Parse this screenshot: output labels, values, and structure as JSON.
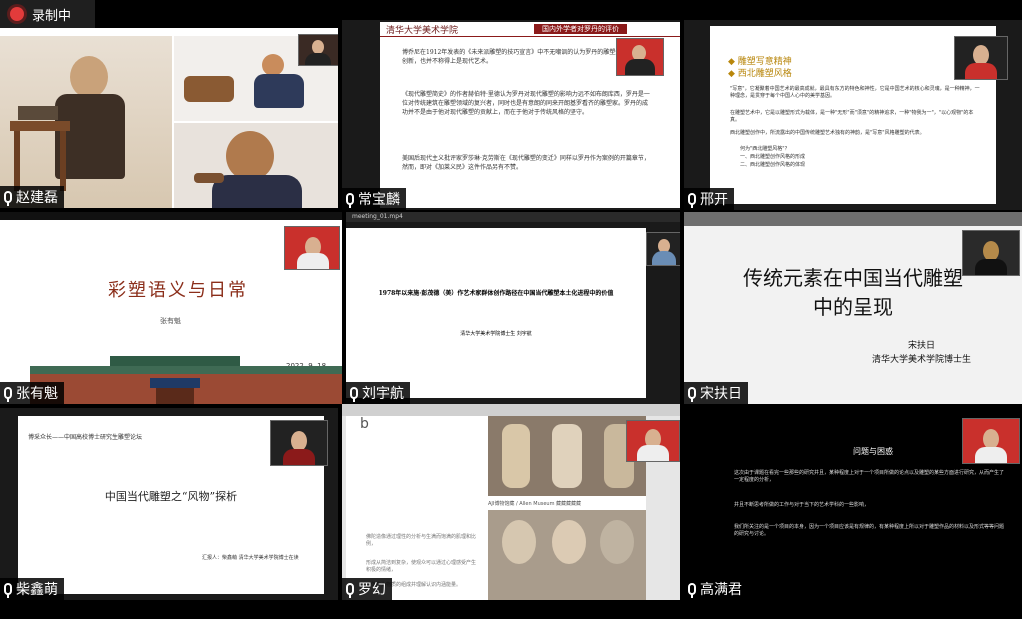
{
  "recording": {
    "label": "录制中"
  },
  "tiles": [
    {
      "name": "赵建磊"
    },
    {
      "name": "常宝麟",
      "slide_header": "清华大学美术学院",
      "slide_section": "国内外学者对罗丹的评价",
      "paras": [
        "博乔尼在1912年发表的《未来派雕塑的技巧宣言》中不无嘲讽的认为罗丹的雕塑并没有完全的创新，也并不称得上是现代艺术。",
        "《现代雕塑简史》的作者赫伯特·里德认为罗丹对现代雕塑的影响力远不如布朗库西，罗丹是一位对传统建筑在雕塑领域的复兴者，同时也是有意朗的同来开朗基罗看齐的雕塑家。罗丹的成功并不是由于他对现代雕塑的贡献上，而在于他对于传统风格的坚守。",
        "美国后现代主义批评家罗莎琳·克劳斯在《现代雕塑的变迁》同样以罗丹作为案例的开篇章节，然而，即对《加莱义民》这件作品另有不赞。"
      ]
    },
    {
      "name": "邢开",
      "bullets": [
        "雕塑写意精神",
        "西北雕塑风格"
      ],
      "paras": [
        "\"写意\"，它凝聚着中国艺术的最高成就，最具有东方的特色和神性，它是中国艺术的核心和灵魂，是一种精神，一种理念，是贯穿于每个中国人心中的美学基因。",
        "在雕塑艺术中，它是以雕塑形式为载体，是一种\"无形\"而\"须意\"的精神追求，一种\"物我为一\"，\"以心观物\"的本真。",
        "西北雕塑创作中，所流露出的中国传统雕塑艺术独有的神韵，是\"写意\"风格雕塑的代表。",
        "何为\"西北雕塑风格\"？",
        "一、西北雕塑创作风格的形成",
        "二、西北雕塑创作风格的体现"
      ]
    },
    {
      "name": "张有魁",
      "title": "彩塑语义与日常",
      "author": "张有魁",
      "date": "2022. 9. 18"
    },
    {
      "name": "刘宇航",
      "title": "1978年以来施·彭茂德（美）作艺术家群体创作路径在中国当代雕塑本土化进程中的价值",
      "subtitle": "清华大学美术学院博士生 刘宇航",
      "filename": "meeting_01.mp4"
    },
    {
      "name": "宋扶日",
      "title_line1": "传统元素在中国当代雕塑",
      "title_line2": "中的呈现",
      "author": "宋扶日",
      "affiliation": "清华大学美术学院博士生"
    },
    {
      "name": "柴鑫萌",
      "forum": "博采众长——中国高校博士研究生雕塑论坛",
      "title": "中国当代雕塑之“风物”探析",
      "reporter": "汇报人：柴鑫萌 清华大学美术学院博士在读"
    },
    {
      "name": "罗幻",
      "letter": "b",
      "caption": "AJI博物馆藏 / Allen Museum 藏藏藏藏藏",
      "paras": [
        "佛陀造像通过理性的分析与生满而饱满的肌理和比例，",
        "形成从简洁到复杂，使观众可以通过心理感受产生积极的情绪，",
        "身体作为物质的组成并理解认识内涵能量。"
      ]
    },
    {
      "name": "高满君",
      "title": "问题与困惑",
      "paras": [
        "这次由于课题在看完一些那些的研究并且，某种程度上对于一个项目所做的论点以及雕塑的某些方面进行研究，从而产生了一定程度的分析，",
        "并且不断思考所做的工作与对于当下的艺术学科的一些影响，",
        "我们所关注的是一个项目的本身，因为一个项目应该是有规律的，有某种程度上所以对于雕塑作品的材料以及形式等等问题的研究与讨论。"
      ]
    }
  ]
}
